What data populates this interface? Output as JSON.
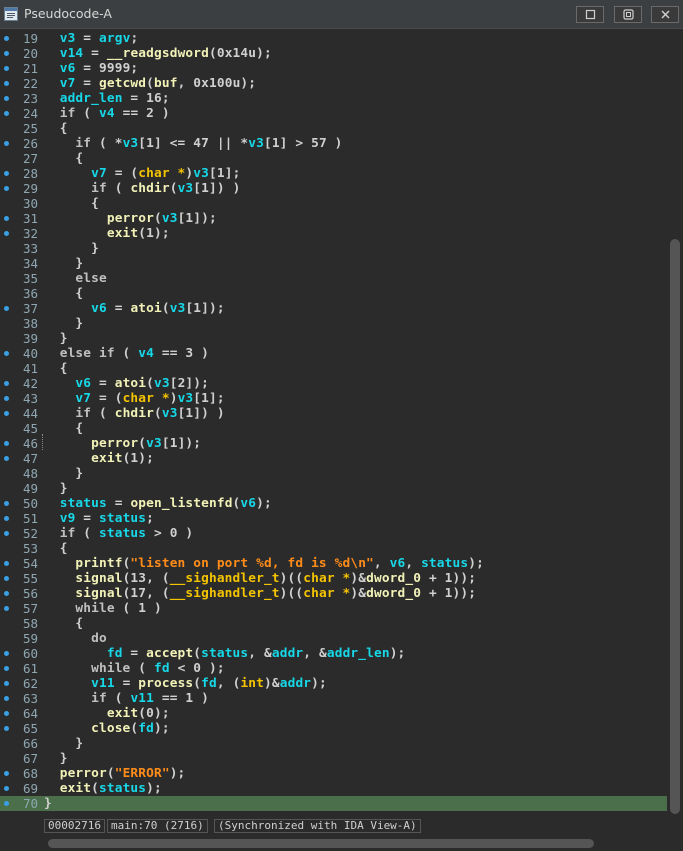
{
  "window": {
    "title": "Pseudocode-A",
    "title_icon": "pseudocode-window-icon",
    "buttons": [
      "restore-button",
      "float-button",
      "close-button"
    ]
  },
  "code": {
    "current_line": 70,
    "lines": [
      {
        "n": "19",
        "dot": true,
        "tokens": [
          [
            "  ",
            "p"
          ],
          [
            "v3",
            "v"
          ],
          [
            " = ",
            "p"
          ],
          [
            "argv",
            "v"
          ],
          [
            ";",
            "p"
          ]
        ]
      },
      {
        "n": "20",
        "dot": true,
        "tokens": [
          [
            "  ",
            "p"
          ],
          [
            "v14",
            "v"
          ],
          [
            " = ",
            "p"
          ],
          [
            "__readgsdword",
            "f"
          ],
          [
            "(0x14u);",
            "p"
          ]
        ]
      },
      {
        "n": "21",
        "dot": true,
        "tokens": [
          [
            "  ",
            "p"
          ],
          [
            "v6",
            "v"
          ],
          [
            " = 9999;",
            "p"
          ]
        ]
      },
      {
        "n": "22",
        "dot": true,
        "tokens": [
          [
            "  ",
            "p"
          ],
          [
            "v7",
            "v"
          ],
          [
            " = ",
            "p"
          ],
          [
            "getcwd",
            "f"
          ],
          [
            "(",
            "p"
          ],
          [
            "buf",
            "f"
          ],
          [
            ", 0x100u);",
            "p"
          ]
        ]
      },
      {
        "n": "23",
        "dot": true,
        "tokens": [
          [
            "  ",
            "p"
          ],
          [
            "addr_len",
            "v"
          ],
          [
            " = 16;",
            "p"
          ]
        ]
      },
      {
        "n": "24",
        "dot": true,
        "tokens": [
          [
            "  ",
            "p"
          ],
          [
            "if",
            "k"
          ],
          [
            " ( ",
            "p"
          ],
          [
            "v4",
            "v"
          ],
          [
            " == 2 )",
            "p"
          ]
        ]
      },
      {
        "n": "25",
        "dot": false,
        "tokens": [
          [
            "  {",
            "p"
          ]
        ]
      },
      {
        "n": "26",
        "dot": true,
        "tokens": [
          [
            "    ",
            "p"
          ],
          [
            "if",
            "k"
          ],
          [
            " ( *",
            "p"
          ],
          [
            "v3",
            "v"
          ],
          [
            "[1] <= 47 || *",
            "p"
          ],
          [
            "v3",
            "v"
          ],
          [
            "[1] > 57 )",
            "p"
          ]
        ]
      },
      {
        "n": "27",
        "dot": false,
        "tokens": [
          [
            "    {",
            "p"
          ]
        ]
      },
      {
        "n": "28",
        "dot": true,
        "tokens": [
          [
            "      ",
            "p"
          ],
          [
            "v7",
            "v"
          ],
          [
            " = (",
            "p"
          ],
          [
            "char *",
            "y"
          ],
          [
            ")",
            "p"
          ],
          [
            "v3",
            "v"
          ],
          [
            "[1];",
            "p"
          ]
        ]
      },
      {
        "n": "29",
        "dot": true,
        "tokens": [
          [
            "      ",
            "p"
          ],
          [
            "if",
            "k"
          ],
          [
            " ( ",
            "p"
          ],
          [
            "chdir",
            "f"
          ],
          [
            "(",
            "p"
          ],
          [
            "v3",
            "v"
          ],
          [
            "[1]) )",
            "p"
          ]
        ]
      },
      {
        "n": "30",
        "dot": false,
        "tokens": [
          [
            "      {",
            "p"
          ]
        ]
      },
      {
        "n": "31",
        "dot": true,
        "tokens": [
          [
            "        ",
            "p"
          ],
          [
            "perror",
            "f"
          ],
          [
            "(",
            "p"
          ],
          [
            "v3",
            "v"
          ],
          [
            "[1]);",
            "p"
          ]
        ]
      },
      {
        "n": "32",
        "dot": true,
        "tokens": [
          [
            "        ",
            "p"
          ],
          [
            "exit",
            "f"
          ],
          [
            "(1);",
            "p"
          ]
        ]
      },
      {
        "n": "33",
        "dot": false,
        "tokens": [
          [
            "      }",
            "p"
          ]
        ]
      },
      {
        "n": "34",
        "dot": false,
        "tokens": [
          [
            "    }",
            "p"
          ]
        ]
      },
      {
        "n": "35",
        "dot": false,
        "tokens": [
          [
            "    ",
            "p"
          ],
          [
            "else",
            "k"
          ]
        ]
      },
      {
        "n": "36",
        "dot": false,
        "tokens": [
          [
            "    {",
            "p"
          ]
        ]
      },
      {
        "n": "37",
        "dot": true,
        "tokens": [
          [
            "      ",
            "p"
          ],
          [
            "v6",
            "v"
          ],
          [
            " = ",
            "p"
          ],
          [
            "atoi",
            "f"
          ],
          [
            "(",
            "p"
          ],
          [
            "v3",
            "v"
          ],
          [
            "[1]);",
            "p"
          ]
        ]
      },
      {
        "n": "38",
        "dot": false,
        "tokens": [
          [
            "    }",
            "p"
          ]
        ]
      },
      {
        "n": "39",
        "dot": false,
        "tokens": [
          [
            "  }",
            "p"
          ]
        ]
      },
      {
        "n": "40",
        "dot": true,
        "tokens": [
          [
            "  ",
            "p"
          ],
          [
            "else if",
            "k"
          ],
          [
            " ( ",
            "p"
          ],
          [
            "v4",
            "v"
          ],
          [
            " == 3 )",
            "p"
          ]
        ]
      },
      {
        "n": "41",
        "dot": false,
        "tokens": [
          [
            "  {",
            "p"
          ]
        ]
      },
      {
        "n": "42",
        "dot": true,
        "tokens": [
          [
            "    ",
            "p"
          ],
          [
            "v6",
            "v"
          ],
          [
            " = ",
            "p"
          ],
          [
            "atoi",
            "f"
          ],
          [
            "(",
            "p"
          ],
          [
            "v3",
            "v"
          ],
          [
            "[2]);",
            "p"
          ]
        ]
      },
      {
        "n": "43",
        "dot": true,
        "tokens": [
          [
            "    ",
            "p"
          ],
          [
            "v7",
            "v"
          ],
          [
            " = (",
            "p"
          ],
          [
            "char *",
            "y"
          ],
          [
            ")",
            "p"
          ],
          [
            "v3",
            "v"
          ],
          [
            "[1];",
            "p"
          ]
        ]
      },
      {
        "n": "44",
        "dot": true,
        "tokens": [
          [
            "    ",
            "p"
          ],
          [
            "if",
            "k"
          ],
          [
            " ( ",
            "p"
          ],
          [
            "chdir",
            "f"
          ],
          [
            "(",
            "p"
          ],
          [
            "v3",
            "v"
          ],
          [
            "[1]) )",
            "p"
          ]
        ]
      },
      {
        "n": "45",
        "dot": false,
        "tokens": [
          [
            "    {",
            "p"
          ]
        ]
      },
      {
        "n": "46",
        "dot": true,
        "tokens": [
          [
            "      ",
            "p"
          ],
          [
            "perror",
            "f"
          ],
          [
            "(",
            "p"
          ],
          [
            "v3",
            "v"
          ],
          [
            "[1]);",
            "p"
          ]
        ]
      },
      {
        "n": "47",
        "dot": true,
        "tokens": [
          [
            "      ",
            "p"
          ],
          [
            "exit",
            "f"
          ],
          [
            "(1);",
            "p"
          ]
        ]
      },
      {
        "n": "48",
        "dot": false,
        "tokens": [
          [
            "    }",
            "p"
          ]
        ]
      },
      {
        "n": "49",
        "dot": false,
        "tokens": [
          [
            "  }",
            "p"
          ]
        ]
      },
      {
        "n": "50",
        "dot": true,
        "tokens": [
          [
            "  ",
            "p"
          ],
          [
            "status",
            "v"
          ],
          [
            " = ",
            "p"
          ],
          [
            "open_listenfd",
            "f"
          ],
          [
            "(",
            "p"
          ],
          [
            "v6",
            "v"
          ],
          [
            ");",
            "p"
          ]
        ]
      },
      {
        "n": "51",
        "dot": true,
        "tokens": [
          [
            "  ",
            "p"
          ],
          [
            "v9",
            "v"
          ],
          [
            " = ",
            "p"
          ],
          [
            "status",
            "v"
          ],
          [
            ";",
            "p"
          ]
        ]
      },
      {
        "n": "52",
        "dot": true,
        "tokens": [
          [
            "  ",
            "p"
          ],
          [
            "if",
            "k"
          ],
          [
            " ( ",
            "p"
          ],
          [
            "status",
            "v"
          ],
          [
            " > 0 )",
            "p"
          ]
        ]
      },
      {
        "n": "53",
        "dot": false,
        "tokens": [
          [
            "  {",
            "p"
          ]
        ]
      },
      {
        "n": "54",
        "dot": true,
        "tokens": [
          [
            "    ",
            "p"
          ],
          [
            "printf",
            "f"
          ],
          [
            "(",
            "p"
          ],
          [
            "\"listen on port %d, fd is %d\\n\"",
            "s"
          ],
          [
            ", ",
            "p"
          ],
          [
            "v6",
            "v"
          ],
          [
            ", ",
            "p"
          ],
          [
            "status",
            "v"
          ],
          [
            ");",
            "p"
          ]
        ]
      },
      {
        "n": "55",
        "dot": true,
        "tokens": [
          [
            "    ",
            "p"
          ],
          [
            "signal",
            "f"
          ],
          [
            "(13, (",
            "p"
          ],
          [
            "__sighandler_t",
            "y"
          ],
          [
            ")((",
            "p"
          ],
          [
            "char *",
            "y"
          ],
          [
            ")&",
            "p"
          ],
          [
            "dword_0",
            "f"
          ],
          [
            " + 1));",
            "p"
          ]
        ]
      },
      {
        "n": "56",
        "dot": true,
        "tokens": [
          [
            "    ",
            "p"
          ],
          [
            "signal",
            "f"
          ],
          [
            "(17, (",
            "p"
          ],
          [
            "__sighandler_t",
            "y"
          ],
          [
            ")((",
            "p"
          ],
          [
            "char *",
            "y"
          ],
          [
            ")&",
            "p"
          ],
          [
            "dword_0",
            "f"
          ],
          [
            " + 1));",
            "p"
          ]
        ]
      },
      {
        "n": "57",
        "dot": true,
        "tokens": [
          [
            "    ",
            "p"
          ],
          [
            "while",
            "k"
          ],
          [
            " ( 1 )",
            "p"
          ]
        ]
      },
      {
        "n": "58",
        "dot": false,
        "tokens": [
          [
            "    {",
            "p"
          ]
        ]
      },
      {
        "n": "59",
        "dot": false,
        "tokens": [
          [
            "      ",
            "p"
          ],
          [
            "do",
            "k"
          ]
        ]
      },
      {
        "n": "60",
        "dot": true,
        "tokens": [
          [
            "        ",
            "p"
          ],
          [
            "fd",
            "v"
          ],
          [
            " = ",
            "p"
          ],
          [
            "accept",
            "f"
          ],
          [
            "(",
            "p"
          ],
          [
            "status",
            "v"
          ],
          [
            ", &",
            "p"
          ],
          [
            "addr",
            "v"
          ],
          [
            ", &",
            "p"
          ],
          [
            "addr_len",
            "v"
          ],
          [
            ");",
            "p"
          ]
        ]
      },
      {
        "n": "61",
        "dot": true,
        "tokens": [
          [
            "      ",
            "p"
          ],
          [
            "while",
            "k"
          ],
          [
            " ( ",
            "p"
          ],
          [
            "fd",
            "v"
          ],
          [
            " < 0 );",
            "p"
          ]
        ]
      },
      {
        "n": "62",
        "dot": true,
        "tokens": [
          [
            "      ",
            "p"
          ],
          [
            "v11",
            "v"
          ],
          [
            " = ",
            "p"
          ],
          [
            "process",
            "f"
          ],
          [
            "(",
            "p"
          ],
          [
            "fd",
            "v"
          ],
          [
            ", (",
            "p"
          ],
          [
            "int",
            "y"
          ],
          [
            ")&",
            "p"
          ],
          [
            "addr",
            "v"
          ],
          [
            ");",
            "p"
          ]
        ]
      },
      {
        "n": "63",
        "dot": true,
        "tokens": [
          [
            "      ",
            "p"
          ],
          [
            "if",
            "k"
          ],
          [
            " ( ",
            "p"
          ],
          [
            "v11",
            "v"
          ],
          [
            " == 1 )",
            "p"
          ]
        ]
      },
      {
        "n": "64",
        "dot": true,
        "tokens": [
          [
            "        ",
            "p"
          ],
          [
            "exit",
            "f"
          ],
          [
            "(0);",
            "p"
          ]
        ]
      },
      {
        "n": "65",
        "dot": true,
        "tokens": [
          [
            "      ",
            "p"
          ],
          [
            "close",
            "f"
          ],
          [
            "(",
            "p"
          ],
          [
            "fd",
            "v"
          ],
          [
            ");",
            "p"
          ]
        ]
      },
      {
        "n": "66",
        "dot": false,
        "tokens": [
          [
            "    }",
            "p"
          ]
        ]
      },
      {
        "n": "67",
        "dot": false,
        "tokens": [
          [
            "  }",
            "p"
          ]
        ]
      },
      {
        "n": "68",
        "dot": true,
        "tokens": [
          [
            "  ",
            "p"
          ],
          [
            "perror",
            "f"
          ],
          [
            "(",
            "p"
          ],
          [
            "\"ERROR\"",
            "s"
          ],
          [
            ");",
            "p"
          ]
        ]
      },
      {
        "n": "69",
        "dot": true,
        "tokens": [
          [
            "  ",
            "p"
          ],
          [
            "exit",
            "f"
          ],
          [
            "(",
            "p"
          ],
          [
            "status",
            "v"
          ],
          [
            ");",
            "p"
          ]
        ]
      },
      {
        "n": "70",
        "dot": true,
        "tokens": [
          [
            "}",
            "p"
          ]
        ]
      }
    ]
  },
  "status": {
    "address": "00002716",
    "location": "main:70 (2716)",
    "sync": "(Synchronized with IDA View-A)"
  },
  "colors": {
    "variable": "#17d8e8",
    "function": "#f2f2b8",
    "type": "#f5c400",
    "string": "#ff8c1a",
    "current_line_bg": "#4a6f4a",
    "bullet": "#3aa0e6"
  }
}
